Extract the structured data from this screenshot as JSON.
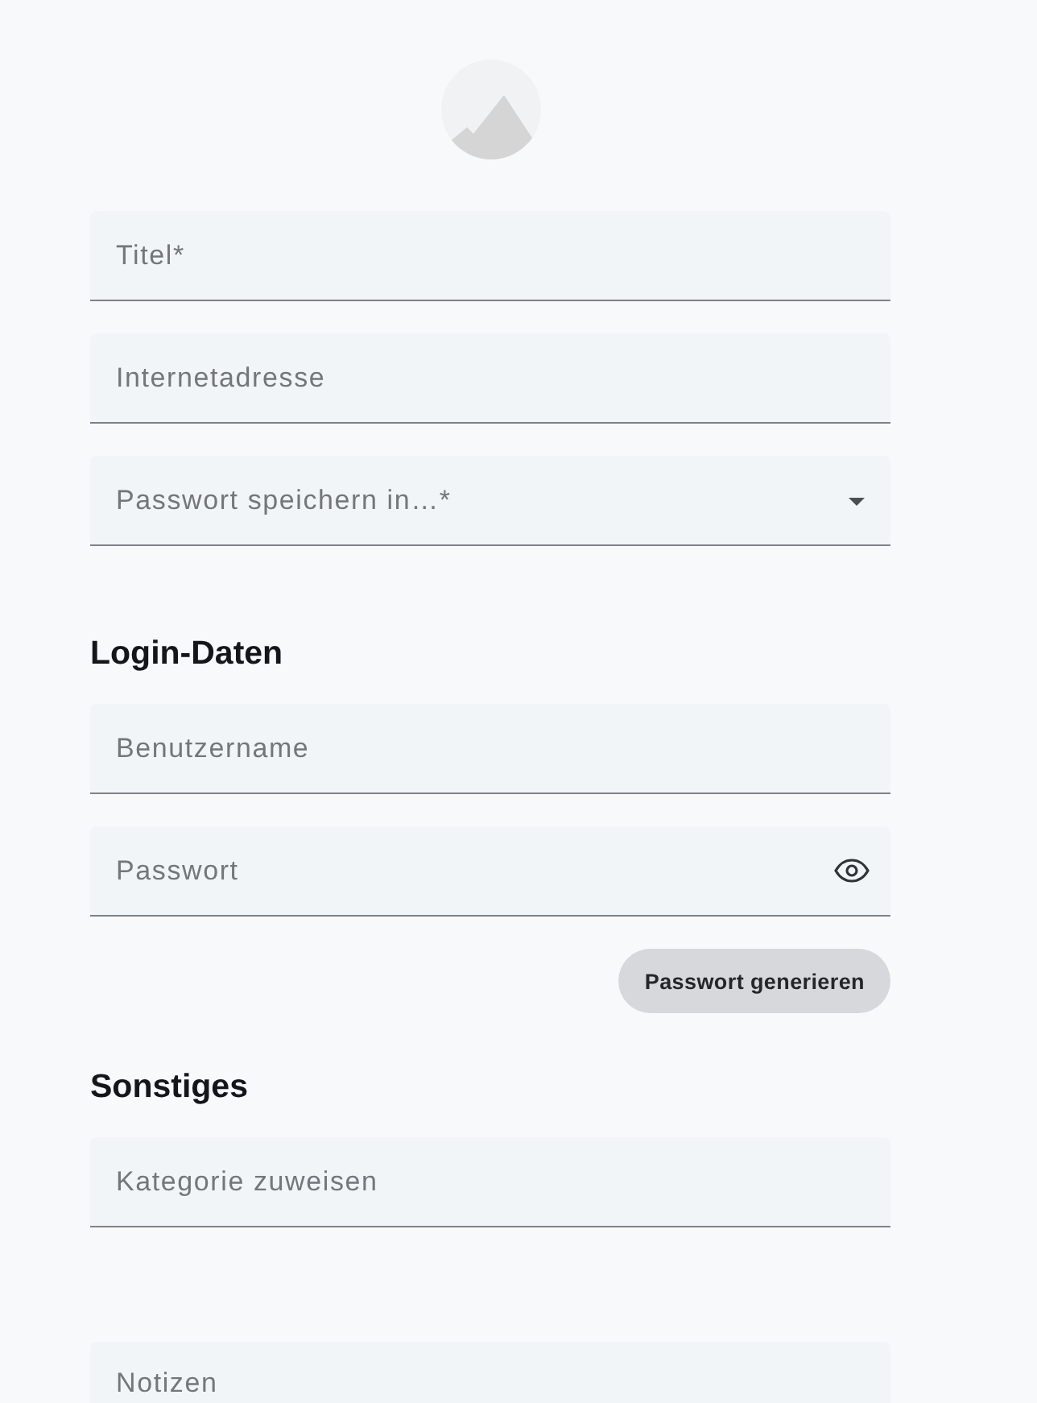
{
  "fields": [
    {
      "kind": "text",
      "placeholder": "Titel*"
    },
    {
      "kind": "text",
      "placeholder": "Internetadresse"
    },
    {
      "kind": "select",
      "placeholder": "Passwort speichern in…*"
    }
  ],
  "sections": [
    {
      "heading": "Login-Daten",
      "fields": [
        {
          "kind": "text",
          "placeholder": "Benutzername"
        },
        {
          "kind": "password",
          "placeholder": "Passwort"
        }
      ],
      "button": "Passwort generieren"
    },
    {
      "heading": "Sonstiges",
      "fields": [
        {
          "kind": "text",
          "placeholder": "Kategorie zuweisen"
        },
        {
          "kind": "textarea",
          "placeholder": "Notizen"
        }
      ]
    }
  ]
}
